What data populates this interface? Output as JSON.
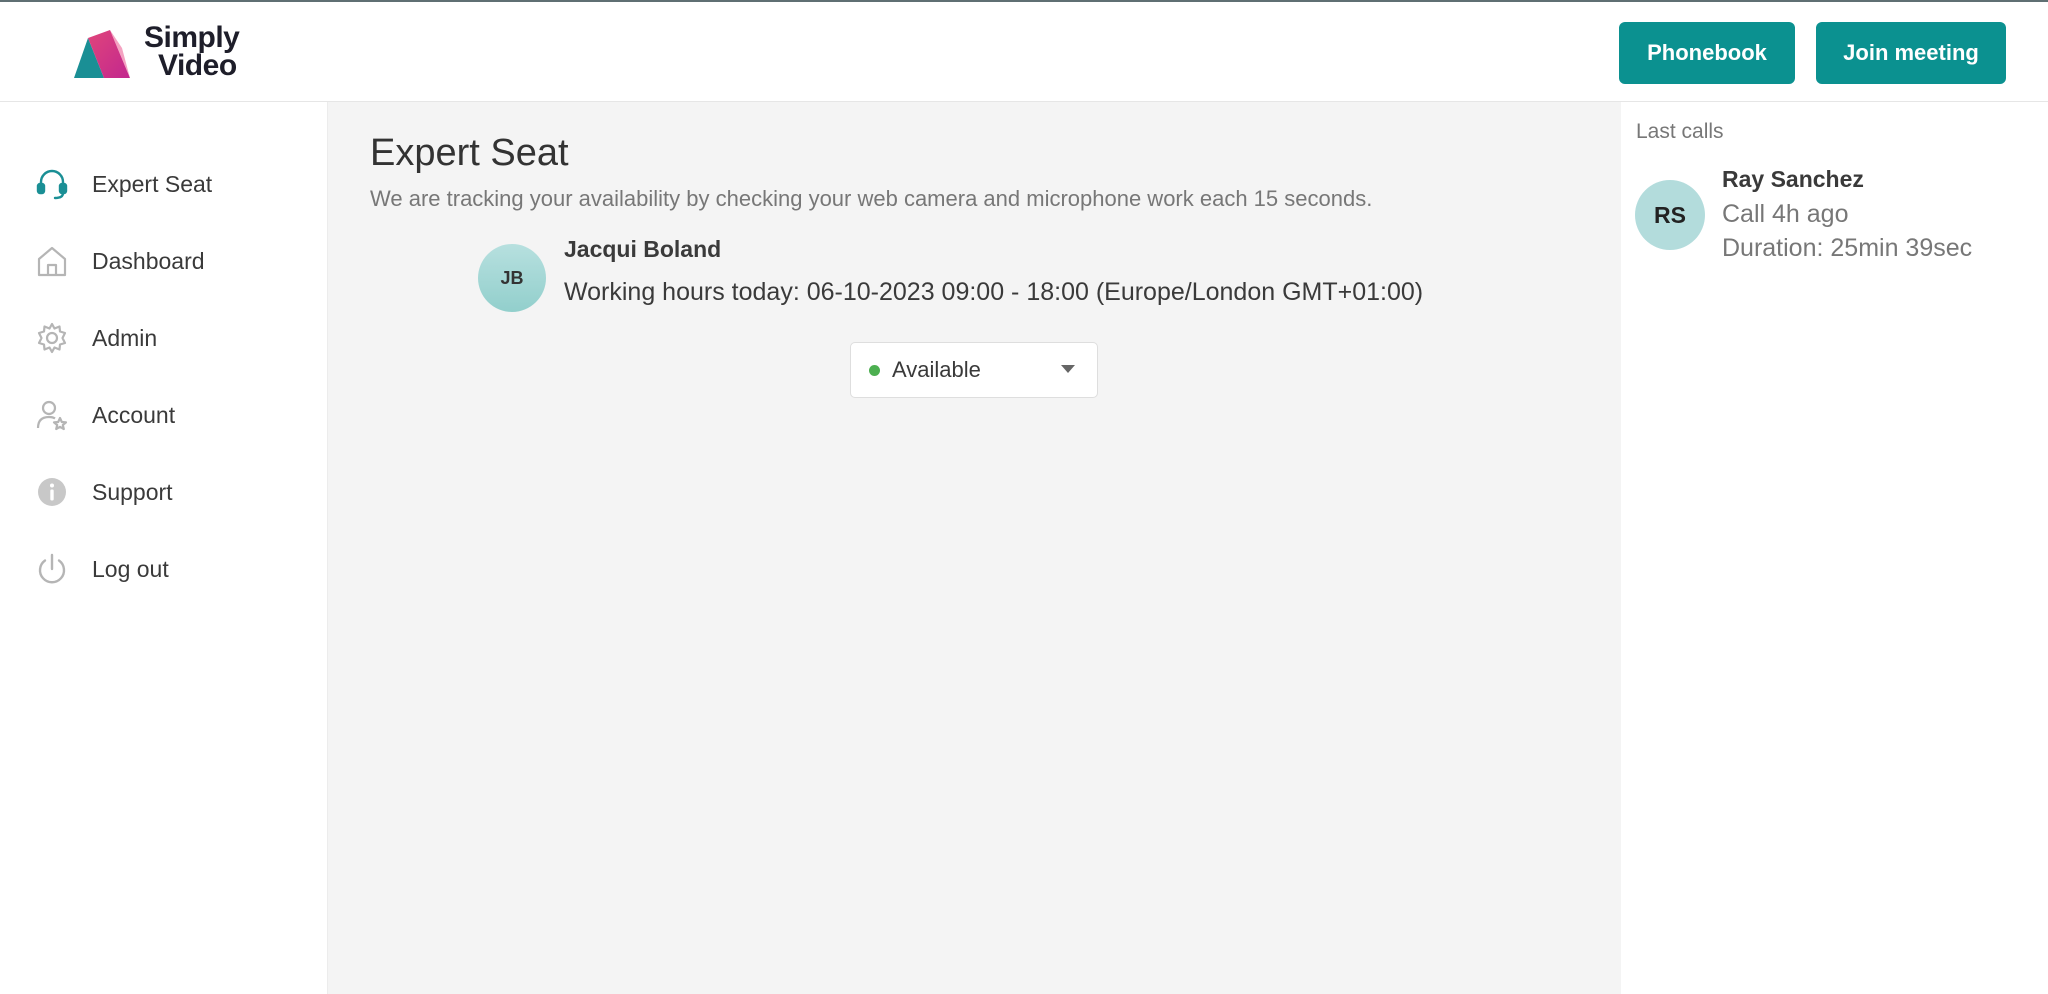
{
  "header": {
    "logo_line1": "Simply",
    "logo_line2": "Video",
    "phonebook_label": "Phonebook",
    "join_label": "Join meeting"
  },
  "sidebar": {
    "items": [
      {
        "label": "Expert Seat",
        "icon": "headset-icon"
      },
      {
        "label": "Dashboard",
        "icon": "home-icon"
      },
      {
        "label": "Admin",
        "icon": "gear-icon"
      },
      {
        "label": "Account",
        "icon": "user-star-icon"
      },
      {
        "label": "Support",
        "icon": "info-icon"
      },
      {
        "label": "Log out",
        "icon": "power-icon"
      }
    ]
  },
  "main": {
    "title": "Expert Seat",
    "subtitle": "We are tracking your availability by checking your web camera and microphone work each 15 seconds.",
    "user": {
      "initials": "JB",
      "name": "Jacqui Boland",
      "hours": "Working hours today: 06-10-2023 09:00 - 18:00 (Europe/London GMT+01:00)"
    },
    "status": {
      "selected": "Available",
      "dot_color": "#4caf50"
    }
  },
  "right_panel": {
    "title": "Last calls",
    "calls": [
      {
        "initials": "RS",
        "name": "Ray Sanchez",
        "time": "Call 4h ago",
        "duration": "Duration: 25min 39sec"
      }
    ]
  },
  "colors": {
    "accent": "#0b9190",
    "active_icon": "#1a8f95",
    "icon_gray": "#b5b5b5"
  }
}
